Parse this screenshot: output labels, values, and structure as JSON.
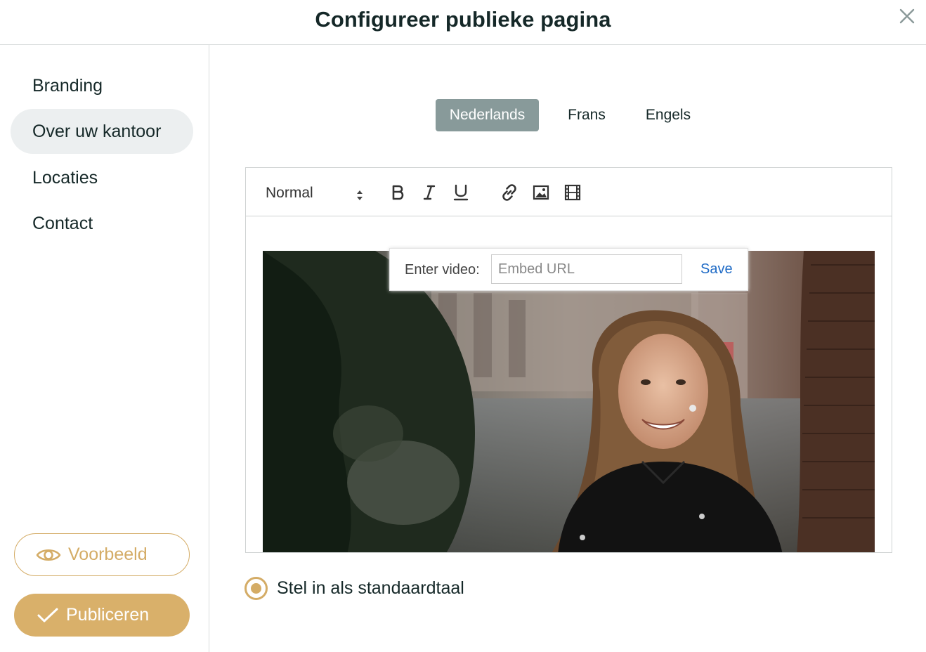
{
  "header": {
    "title": "Configureer publieke pagina",
    "close_icon": "close-icon"
  },
  "sidebar": {
    "items": [
      {
        "label": "Branding",
        "active": false
      },
      {
        "label": "Over uw kantoor",
        "active": true
      },
      {
        "label": "Locaties",
        "active": false
      },
      {
        "label": "Contact",
        "active": false
      }
    ],
    "preview_label": "Voorbeeld",
    "preview_icon": "eye-icon",
    "publish_label": "Publiceren",
    "publish_icon": "check-icon"
  },
  "languages": {
    "tabs": [
      {
        "label": "Nederlands",
        "active": true
      },
      {
        "label": "Frans",
        "active": false
      },
      {
        "label": "Engels",
        "active": false
      }
    ]
  },
  "editor": {
    "format_value": "Normal",
    "toolbar_icons": [
      "bold-icon",
      "italic-icon",
      "underline-icon",
      "link-icon",
      "image-icon",
      "video-icon"
    ],
    "video_tooltip": {
      "label": "Enter video:",
      "placeholder": "Embed URL",
      "save_label": "Save"
    }
  },
  "default_language": {
    "label": "Stel in als standaardtaal",
    "checked": true
  },
  "colors": {
    "accent": "#d4ac66",
    "active_tab": "#889a9a",
    "link": "#1f6bc6",
    "text": "#152828"
  }
}
